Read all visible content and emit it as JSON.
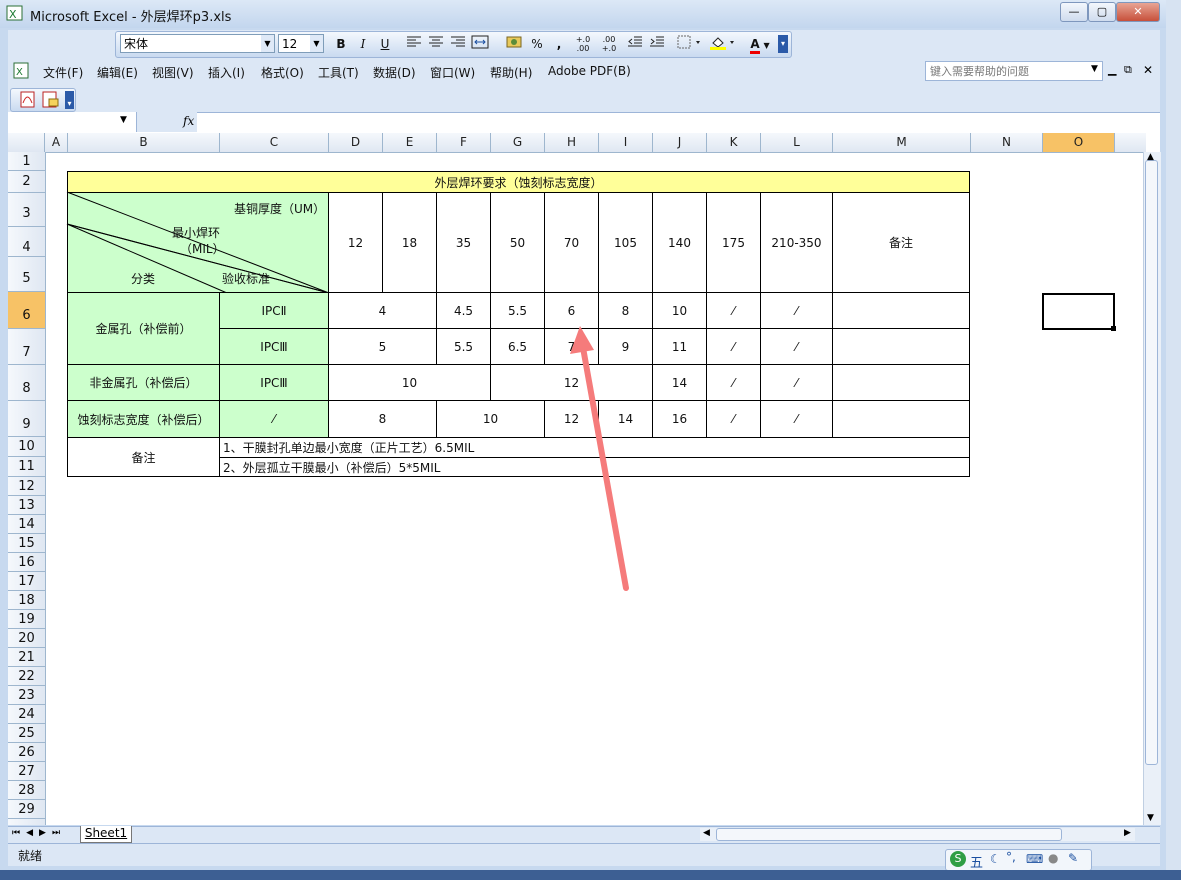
{
  "window": {
    "title": "Microsoft Excel - 外层焊环p3.xls",
    "min": "—",
    "max": "▢",
    "close": "✕"
  },
  "format_toolbar": {
    "font_name": "宋体",
    "font_size": "12",
    "bold": "B",
    "italic": "I",
    "underline": "U",
    "percent": "%",
    "comma": ",",
    "inc_decimal": "+.0 .00",
    "dec_decimal": ".00 +.0",
    "font_color": "A"
  },
  "menu": {
    "items": [
      "文件(F)",
      "编辑(E)",
      "视图(V)",
      "插入(I)",
      "格式(O)",
      "工具(T)",
      "数据(D)",
      "窗口(W)",
      "帮助(H)",
      "Adobe PDF(B)"
    ],
    "help_placeholder": "键入需要帮助的问题"
  },
  "formula_bar": {
    "fx": "fx",
    "name_box": ""
  },
  "columns": [
    "A",
    "B",
    "C",
    "D",
    "E",
    "F",
    "G",
    "H",
    "I",
    "J",
    "K",
    "L",
    "M",
    "N",
    "O"
  ],
  "rows": [
    "1",
    "2",
    "3",
    "4",
    "5",
    "6",
    "7",
    "8",
    "9",
    "10",
    "11",
    "12",
    "13",
    "14",
    "15",
    "16",
    "17",
    "18",
    "19",
    "20",
    "21",
    "22",
    "23",
    "24",
    "25",
    "26",
    "27",
    "28",
    "29"
  ],
  "table": {
    "title": "外层焊环要求（蚀刻标志宽度）",
    "corner": {
      "top": "基铜厚度（UM）",
      "middle1": "最小焊环",
      "middle2": "（MIL）",
      "left": "分类",
      "bottom": "验收标准"
    },
    "headers": [
      "12",
      "18",
      "35",
      "50",
      "70",
      "105",
      "140",
      "175",
      "210-350",
      "备注"
    ],
    "metal_hole": "金属孔（补偿前）",
    "ipc2": "IPCⅡ",
    "ipc3": "IPCⅢ",
    "row_ipc2": {
      "d_e": "4",
      "f": "4.5",
      "g": "5.5",
      "h": "6",
      "i": "8",
      "j": "10",
      "k": "⁄",
      "l": "⁄"
    },
    "row_ipc3": {
      "d_e": "5",
      "f": "5.5",
      "g": "6.5",
      "h": "7",
      "i": "9",
      "j": "11",
      "k": "⁄",
      "l": "⁄"
    },
    "nonmetal": {
      "label": "非金属孔（补偿后）",
      "std": "IPCⅢ",
      "d_f": "10",
      "g_i": "12",
      "j": "14",
      "k": "⁄",
      "l": "⁄"
    },
    "etch": {
      "label": "蚀刻标志宽度（补偿后）",
      "std": "⁄",
      "d_e": "8",
      "f_g": "10",
      "h": "12",
      "i": "14",
      "j": "16",
      "k": "⁄",
      "l": "⁄"
    },
    "remark_label": "备注",
    "note1": "1、干膜封孔单边最小宽度（正片工艺）6.5MIL",
    "note2": "2、外层孤立干膜最小（补偿后）5*5MIL"
  },
  "sheet_tab": "Sheet1",
  "status": "就绪",
  "ime": {
    "label": "五"
  },
  "colors": {
    "green": "#ccffcc",
    "yellow": "#ffff99",
    "arrow": "#f57b7b"
  }
}
